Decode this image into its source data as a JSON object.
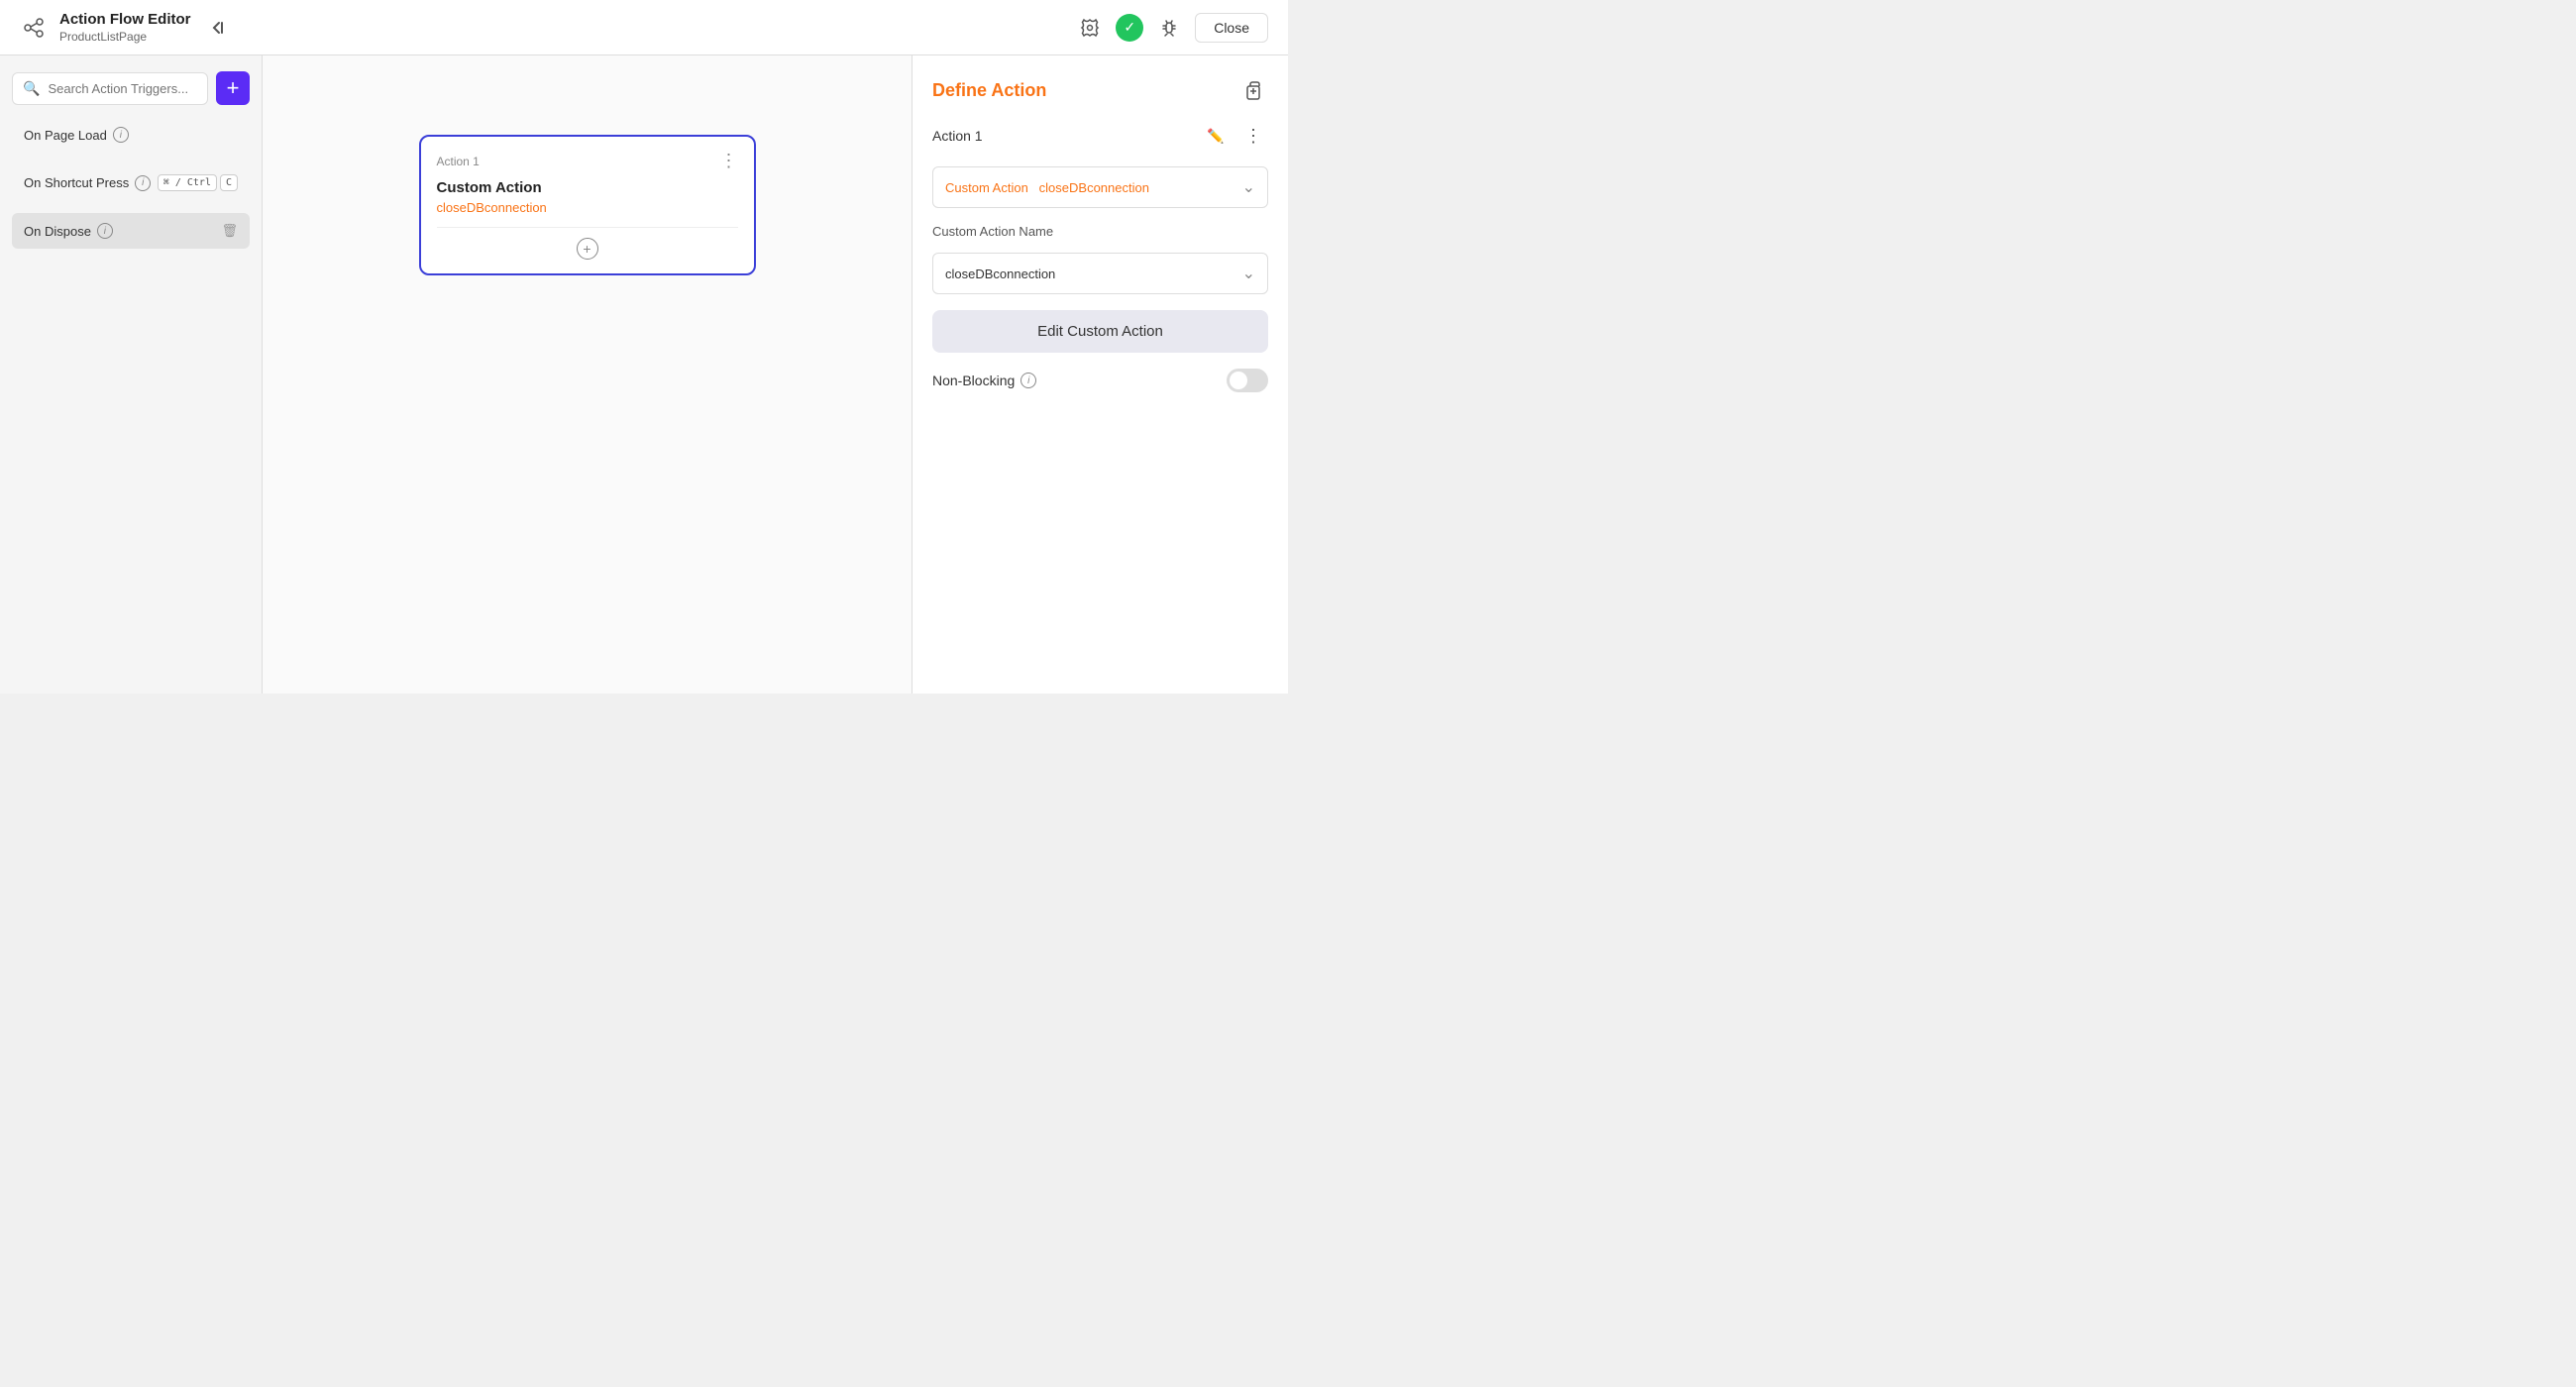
{
  "topbar": {
    "title": "Action Flow Editor",
    "subtitle": "ProductListPage",
    "collapse_label": "◀",
    "close_label": "Close"
  },
  "sidebar": {
    "search_placeholder": "Search Action Triggers...",
    "add_label": "+",
    "triggers": [
      {
        "id": "on-page-load",
        "label": "On Page Load",
        "active": false,
        "shortcut": null
      },
      {
        "id": "on-shortcut-press",
        "label": "On Shortcut Press",
        "active": false,
        "shortcut": {
          "keys": [
            "⌘ / Ctrl",
            "C"
          ]
        }
      },
      {
        "id": "on-dispose",
        "label": "On Dispose",
        "active": true,
        "shortcut": null
      }
    ]
  },
  "canvas": {
    "card": {
      "label": "Action 1",
      "title": "Custom Action",
      "subtitle": "closeDBconnection",
      "menu_icon": "⋮"
    }
  },
  "right_panel": {
    "title": "Define Action",
    "action_name": "Action 1",
    "custom_action_dropdown": {
      "prefix": "Custom Action",
      "value": "closeDBconnection"
    },
    "custom_action_name_label": "Custom Action Name",
    "custom_action_name_value": "closeDBconnection",
    "edit_button_label": "Edit Custom Action",
    "non_blocking_label": "Non-Blocking"
  },
  "icons": {
    "search": "🔍",
    "info": "i",
    "edit": "✏️",
    "more": "⋮",
    "copy": "⧉",
    "bug": "🐛",
    "check": "✓",
    "chevron_down": "⌄",
    "trash": "🗑"
  }
}
